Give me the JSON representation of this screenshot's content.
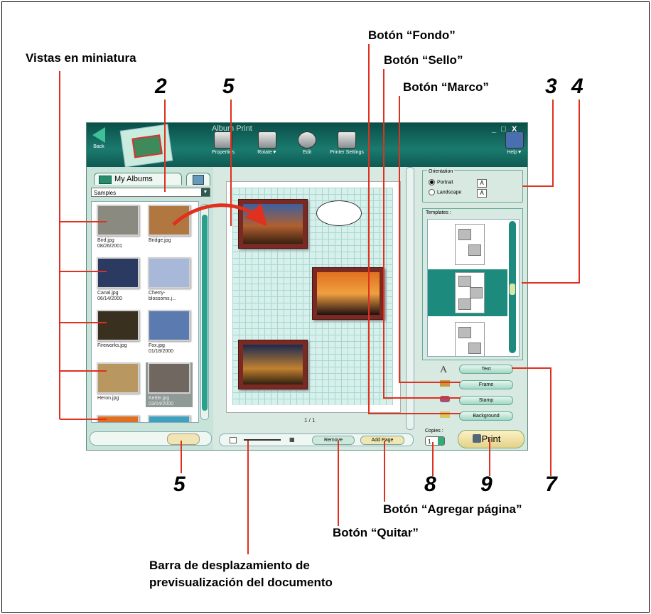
{
  "callouts": {
    "thumbnails": "Vistas en miniatura",
    "background_btn": "Botón “Fondo”",
    "stamp_btn": "Botón “Sello”",
    "frame_btn": "Botón “Marco”",
    "add_page_btn": "Botón “Agregar página”",
    "remove_btn": "Botón “Quitar”",
    "scroll_bar_line1": "Barra de desplazamiento de",
    "scroll_bar_line2": "previsualización del documento"
  },
  "numbers": {
    "n2": "2",
    "n5_top": "5",
    "n3": "3",
    "n4": "4",
    "n5_bottom": "5",
    "n8": "8",
    "n9": "9",
    "n7": "7"
  },
  "window": {
    "title": "Album Print",
    "back": "Back",
    "toolbar": [
      {
        "label": "Properties",
        "icon": "properties-icon"
      },
      {
        "label": "Rotate▼",
        "icon": "rotate-icon"
      },
      {
        "label": "Edit",
        "icon": "edit-icon"
      },
      {
        "label": "Printer Settings",
        "icon": "printer-settings-icon"
      }
    ],
    "help": "Help▼",
    "controls": {
      "minimize": "_",
      "maximize": "□",
      "close": "X"
    }
  },
  "left_panel": {
    "tab": "My Albums",
    "album_select": "Samples",
    "thumbnails": [
      {
        "name": "Bird.jpg",
        "date": "08/26/2001",
        "color": "#8a8a80"
      },
      {
        "name": "Bridge.jpg",
        "date": "",
        "color": "#b07840"
      },
      {
        "name": "Canal.jpg",
        "date": "06/14/2000",
        "color": "#2a3a60"
      },
      {
        "name": "Cherry-blossoms.j...",
        "date": "",
        "color": "#a8b8d8"
      },
      {
        "name": "Fireworks.jpg",
        "date": "",
        "color": "#3a3020"
      },
      {
        "name": "Fox.jpg",
        "date": "01/18/2000",
        "color": "#5a7ab0"
      },
      {
        "name": "Heron.jpg",
        "date": "",
        "color": "#b89860"
      },
      {
        "name": "Kettle.jpg",
        "date": "03/04/2000",
        "color": "#706860"
      },
      {
        "name": "",
        "date": "",
        "color": "#e07020"
      },
      {
        "name": "",
        "date": "",
        "color": "#40a0c0"
      }
    ]
  },
  "preview": {
    "page_indicator": "1 / 1",
    "remove_label": "Remove",
    "add_page_label": "Add Page"
  },
  "right_panel": {
    "orientation_legend": "Orientation",
    "portrait": "Portrait",
    "landscape": "Landscape",
    "templates_legend": "Templates :",
    "text_btn": "Text",
    "frame_btn": "Frame",
    "stamp_btn": "Stamp",
    "background_btn": "Background",
    "copies_label": "Copies :",
    "copies_value": "1",
    "print_btn": "Print"
  }
}
